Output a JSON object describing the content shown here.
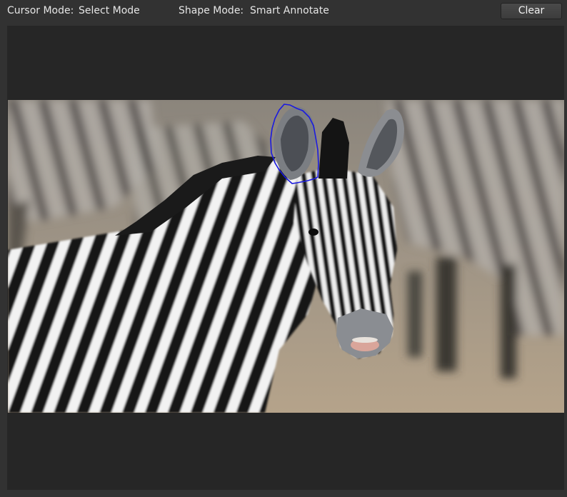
{
  "toolbar": {
    "cursor_mode_label": "Cursor Mode:",
    "cursor_mode_value": "Select Mode",
    "shape_mode_label": "Shape Mode:",
    "shape_mode_value": "Smart Annotate",
    "clear_label": "Clear"
  },
  "annotation": {
    "color": "#1a1ae0"
  },
  "colors": {
    "window_bg": "#323232",
    "canvas_bg": "#262626"
  }
}
